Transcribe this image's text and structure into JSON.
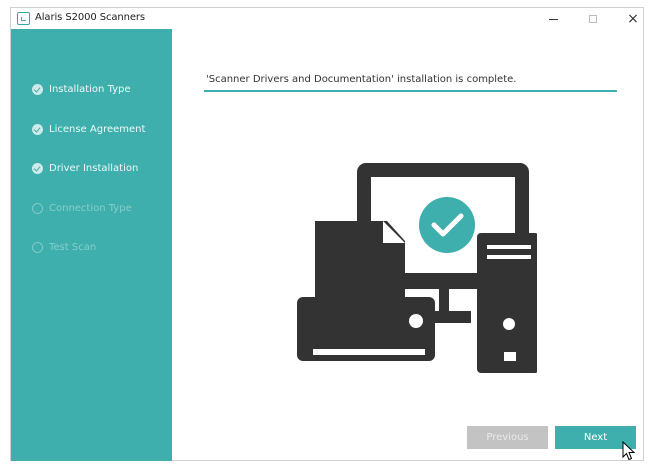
{
  "window": {
    "title": "Alaris S2000 Scanners",
    "controls": {
      "minimize": "minimize",
      "maximize": "maximize",
      "close": "×"
    }
  },
  "sidebar": {
    "steps": [
      {
        "label": "Installation Type",
        "state": "done"
      },
      {
        "label": "License Agreement",
        "state": "done"
      },
      {
        "label": "Driver Installation",
        "state": "done"
      },
      {
        "label": "Connection Type",
        "state": "pending"
      },
      {
        "label": "Test Scan",
        "state": "pending"
      }
    ]
  },
  "main": {
    "status_message": "'Scanner Drivers and Documentation' installation is complete.",
    "illustration_icon": "computer-scanner-check-icon"
  },
  "buttons": {
    "previous": {
      "label": "Previous",
      "enabled": false
    },
    "next": {
      "label": "Next",
      "enabled": true
    }
  },
  "colors": {
    "accent": "#3eafac",
    "illustration": "#333333",
    "disabled_button": "#c3c3c3"
  }
}
